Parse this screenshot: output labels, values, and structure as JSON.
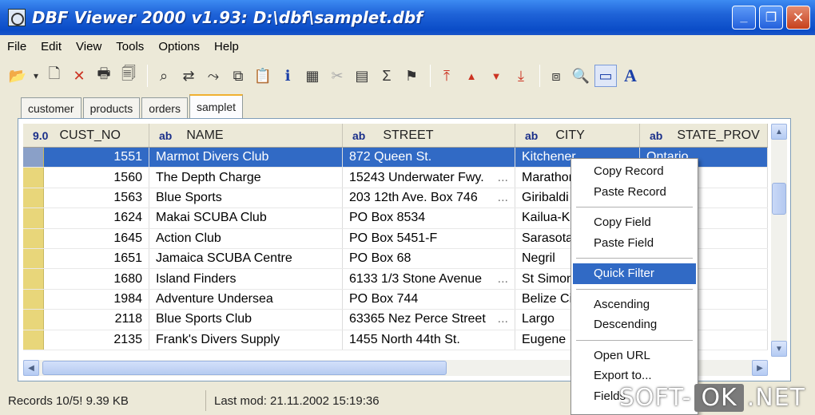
{
  "window": {
    "title": "DBF Viewer 2000 v1.93: D:\\dbf\\samplet.dbf",
    "minimize": "_",
    "maximize": "❐",
    "close": "✕"
  },
  "menu": [
    "File",
    "Edit",
    "View",
    "Tools",
    "Options",
    "Help"
  ],
  "toolbar": [
    {
      "icon": "open-folder-icon",
      "glyph": "📂"
    },
    {
      "icon": "dropdown-arrow-icon",
      "glyph": "▾"
    },
    {
      "icon": "new-document-icon",
      "glyph": "🗋"
    },
    {
      "icon": "delete-icon",
      "glyph": "✕"
    },
    {
      "icon": "print-icon",
      "glyph": "🖶"
    },
    {
      "icon": "print-preview-icon",
      "glyph": "🗐"
    },
    {
      "icon": "find-icon",
      "glyph": "⌕"
    },
    {
      "icon": "replace-icon",
      "glyph": "⇄"
    },
    {
      "icon": "goto-icon",
      "glyph": "⤳"
    },
    {
      "icon": "copy-records-icon",
      "glyph": "⧉"
    },
    {
      "icon": "paste-icon",
      "glyph": "📋"
    },
    {
      "icon": "info-icon",
      "glyph": "ℹ"
    },
    {
      "icon": "structure-icon",
      "glyph": "▦"
    },
    {
      "icon": "tools-icon",
      "glyph": "✂"
    },
    {
      "icon": "table-icon",
      "glyph": "▤"
    },
    {
      "icon": "sum-icon",
      "glyph": "Σ"
    },
    {
      "icon": "filter-icon",
      "glyph": "⚑"
    },
    {
      "icon": "first-record-icon",
      "glyph": "⤒"
    },
    {
      "icon": "prev-record-icon",
      "glyph": "▲"
    },
    {
      "icon": "next-record-icon",
      "glyph": "▼"
    },
    {
      "icon": "last-record-icon",
      "glyph": "⤓"
    },
    {
      "icon": "window-icon",
      "glyph": "⧈"
    },
    {
      "icon": "search-icon",
      "glyph": "🔍"
    },
    {
      "icon": "text-mode-icon",
      "glyph": "▭"
    },
    {
      "icon": "font-icon",
      "glyph": "A"
    }
  ],
  "tabs": [
    "customer",
    "products",
    "orders",
    "samplet"
  ],
  "active_tab": "samplet",
  "columns": [
    {
      "type": "9.0",
      "name": "CUST_NO"
    },
    {
      "type": "ab",
      "name": "NAME"
    },
    {
      "type": "ab",
      "name": "STREET"
    },
    {
      "type": "ab",
      "name": "CITY"
    },
    {
      "type": "ab",
      "name": "STATE_PROV"
    }
  ],
  "rows": [
    {
      "cust_no": "1551",
      "name": "Marmot Divers Club",
      "street": "872 Queen St.",
      "street_more": "",
      "city": "Kitchener",
      "state": "Ontario"
    },
    {
      "cust_no": "1560",
      "name": "The Depth Charge",
      "street": "15243 Underwater Fwy.",
      "street_more": "...",
      "city": "Marathon",
      "state": ""
    },
    {
      "cust_no": "1563",
      "name": "Blue Sports",
      "street": "203 12th Ave. Box 746",
      "street_more": "...",
      "city": "Giribaldi",
      "state": ""
    },
    {
      "cust_no": "1624",
      "name": "Makai SCUBA Club",
      "street": "PO Box 8534",
      "street_more": "",
      "city": "Kailua-Kona",
      "state": ""
    },
    {
      "cust_no": "1645",
      "name": "Action Club",
      "street": "PO Box 5451-F",
      "street_more": "",
      "city": "Sarasota",
      "state": ""
    },
    {
      "cust_no": "1651",
      "name": "Jamaica SCUBA Centre",
      "street": "PO Box 68",
      "street_more": "",
      "city": "Negril",
      "state": ""
    },
    {
      "cust_no": "1680",
      "name": "Island Finders",
      "street": "6133 1/3 Stone Avenue",
      "street_more": "...",
      "city": "St Simons",
      "state": ""
    },
    {
      "cust_no": "1984",
      "name": "Adventure Undersea",
      "street": "PO Box 744",
      "street_more": "",
      "city": "Belize City",
      "state": ""
    },
    {
      "cust_no": "2118",
      "name": "Blue Sports Club",
      "street": "63365 Nez Perce Street",
      "street_more": "...",
      "city": "Largo",
      "state": ""
    },
    {
      "cust_no": "2135",
      "name": "Frank's Divers Supply",
      "street": "1455 North 44th St.",
      "street_more": "",
      "city": "Eugene",
      "state": ""
    }
  ],
  "context_menu": {
    "items": [
      {
        "label": "Copy Record",
        "group": 1
      },
      {
        "label": "Paste Record",
        "group": 1
      },
      {
        "label": "Copy Field",
        "group": 2
      },
      {
        "label": "Paste Field",
        "group": 2
      },
      {
        "label": "Quick Filter",
        "group": 3,
        "highlighted": true
      },
      {
        "label": "Ascending",
        "group": 4
      },
      {
        "label": "Descending",
        "group": 4
      },
      {
        "label": "Open URL",
        "group": 5
      },
      {
        "label": "Export to...",
        "group": 5
      },
      {
        "label": "Fields",
        "group": 5
      }
    ]
  },
  "status": {
    "records": "Records 10/5!",
    "size": "9.39 KB",
    "last_mod": "Last mod: 21.11.2002 15:19:36"
  },
  "watermark": {
    "left": "SOFT-",
    "middle": "OK",
    "right": ".NET"
  },
  "colors": {
    "selection": "#316ac5",
    "titlebar": "#0a4cc7",
    "indicator": "#e8d67a"
  }
}
